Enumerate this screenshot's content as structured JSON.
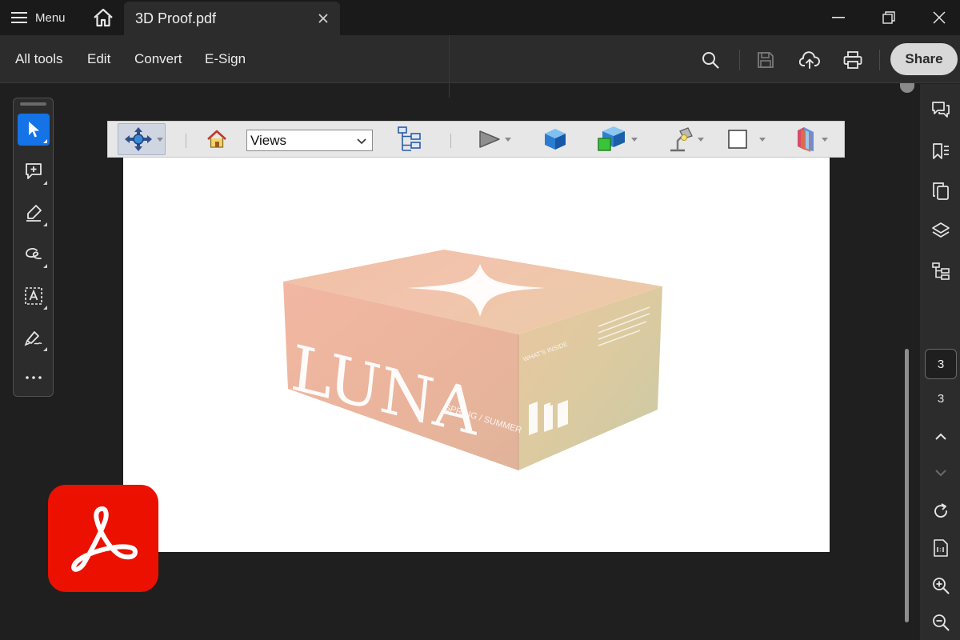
{
  "titlebar": {
    "menu_label": "Menu",
    "tab_title": "3D Proof.pdf"
  },
  "menubar": {
    "items": [
      "All tools",
      "Edit",
      "Convert",
      "E-Sign"
    ],
    "share_label": "Share"
  },
  "toolbar3d": {
    "views_value": "Views"
  },
  "box": {
    "brand": "LUNA",
    "side_text": "SPRING / SUMMER",
    "end_heading": "WHAT'S INSIDE"
  },
  "navigation": {
    "current_page": "3",
    "total_pages": "3"
  },
  "colors": {
    "accent": "#1473e6",
    "acrobat_red": "#eb1000",
    "chrome_dark": "#1f1f1f",
    "panel": "#2c2c2c"
  }
}
